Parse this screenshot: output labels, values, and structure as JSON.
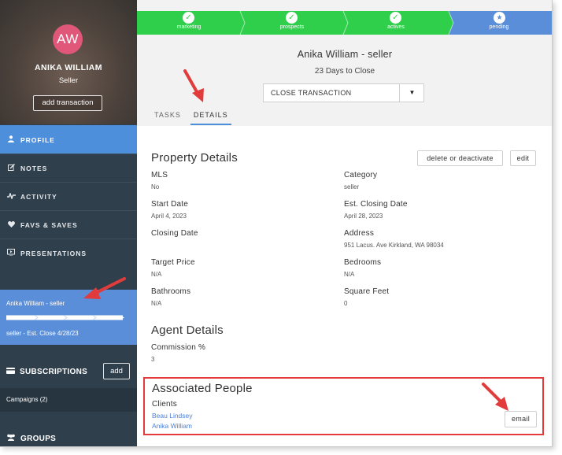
{
  "colors": {
    "sidebar": "#2f3f4c",
    "accent_blue": "#4e8fdc",
    "pipeline_green": "#2fcf4c",
    "pipeline_pending": "#5b8ed9",
    "avatar": "#e0577a",
    "highlight_red": "#e23b3b"
  },
  "sidebar": {
    "avatar_initials": "AW",
    "name": "ANIKA WILLIAM",
    "role": "Seller",
    "add_transaction": "add transaction",
    "nav": [
      {
        "label": "PROFILE",
        "icon": "user-icon"
      },
      {
        "label": "NOTES",
        "icon": "edit-icon"
      },
      {
        "label": "ACTIVITY",
        "icon": "activity-icon"
      },
      {
        "label": "FAVS & SAVES",
        "icon": "heart-icon"
      },
      {
        "label": "PRESENTATIONS",
        "icon": "presentation-icon"
      }
    ],
    "transaction": {
      "title": "Anika William - seller",
      "subtitle": "seller - Est. Close 4/28/23",
      "progress": 1.0
    },
    "subscriptions": {
      "label": "SUBSCRIPTIONS",
      "add": "add",
      "icon": "card-icon"
    },
    "campaigns": "Campaigns (2)",
    "groups": {
      "label": "GROUPS",
      "icon": "users-icon"
    }
  },
  "pipeline": {
    "stages": [
      {
        "label": "marketing",
        "status": "complete"
      },
      {
        "label": "prospects",
        "status": "complete"
      },
      {
        "label": "actives",
        "status": "complete"
      },
      {
        "label": "pending",
        "status": "current"
      }
    ]
  },
  "header": {
    "title": "Anika William - seller",
    "days": "23 Days to Close",
    "select_value": "CLOSE TRANSACTION",
    "tabs": [
      {
        "label": "TASKS"
      },
      {
        "label": "DETAILS"
      }
    ]
  },
  "property": {
    "title": "Property Details",
    "delete": "delete or deactivate",
    "edit": "edit",
    "fields": [
      {
        "label": "MLS",
        "value": "No"
      },
      {
        "label": "Category",
        "value": "seller"
      },
      {
        "label": "Start Date",
        "value": "April 4, 2023"
      },
      {
        "label": "Est. Closing Date",
        "value": "April 28, 2023"
      },
      {
        "label": "Closing Date",
        "value": ""
      },
      {
        "label": "Address",
        "value": "951 Lacus. Ave Kirkland, WA 98034"
      },
      {
        "label": "Target Price",
        "value": "N/A"
      },
      {
        "label": "Bedrooms",
        "value": "N/A"
      },
      {
        "label": "Bathrooms",
        "value": "N/A"
      },
      {
        "label": "Square Feet",
        "value": "0"
      }
    ]
  },
  "agent": {
    "title": "Agent Details",
    "commission_label": "Commission %",
    "commission_value": "3"
  },
  "associated": {
    "title": "Associated People",
    "clients_label": "Clients",
    "clients": [
      "Beau Lindsey",
      "Anika William"
    ],
    "email": "email"
  }
}
